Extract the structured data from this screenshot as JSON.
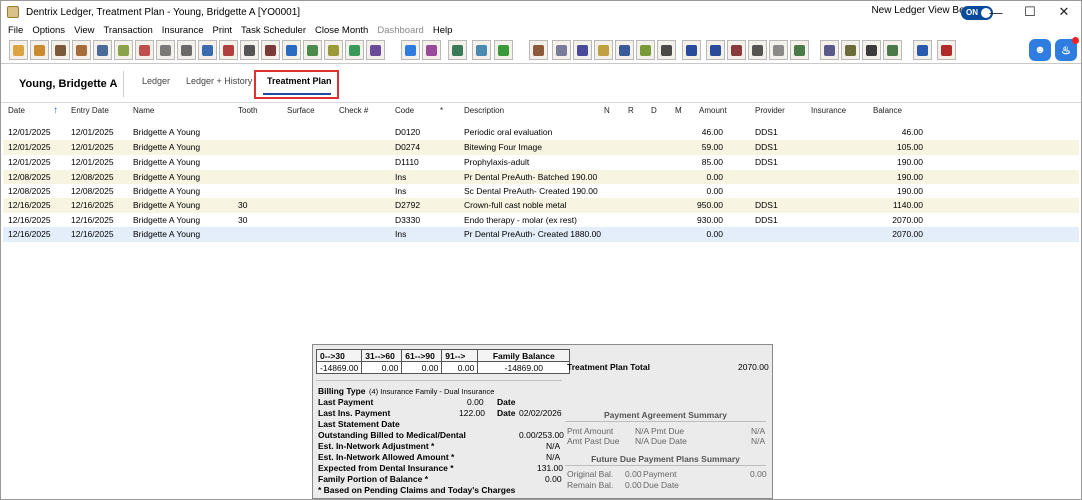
{
  "window": {
    "title": "Dentrix Ledger, Treatment Plan - Young, Bridgette A [YO0001]",
    "beta_label": "New Ledger View Beta",
    "toggle_label": "ON"
  },
  "menu": [
    "File",
    "Options",
    "View",
    "Transaction",
    "Insurance",
    "Print",
    "Task Scheduler",
    "Close Month",
    "Dashboard",
    "Help"
  ],
  "patient_name": "Young, Bridgette A",
  "tabs": [
    "Ledger",
    "Ledger + History",
    "Treatment Plan"
  ],
  "columns": [
    "Date",
    "Entry Date",
    "Name",
    "Tooth",
    "Surface",
    "Check #",
    "Code",
    "*",
    "Description",
    "N",
    "R",
    "D",
    "M",
    "Amount",
    "Provider",
    "Insurance",
    "Balance"
  ],
  "rows": [
    {
      "date": "12/01/2025",
      "entry": "12/01/2025",
      "name": "Bridgette A Young",
      "tooth": "",
      "code": "D0120",
      "desc": "Periodic oral evaluation",
      "amount": "46.00",
      "provider": "DDS1",
      "balance": "46.00"
    },
    {
      "date": "12/01/2025",
      "entry": "12/01/2025",
      "name": "Bridgette A Young",
      "tooth": "",
      "code": "D0274",
      "desc": "Bitewing Four Image",
      "amount": "59.00",
      "provider": "DDS1",
      "balance": "105.00"
    },
    {
      "date": "12/01/2025",
      "entry": "12/01/2025",
      "name": "Bridgette A Young",
      "tooth": "",
      "code": "D1110",
      "desc": "Prophylaxis-adult",
      "amount": "85.00",
      "provider": "DDS1",
      "balance": "190.00"
    },
    {
      "date": "12/08/2025",
      "entry": "12/08/2025",
      "name": "Bridgette A Young",
      "tooth": "",
      "code": "Ins",
      "desc": "Pr Dental PreAuth- Batched 190.00",
      "amount": "0.00",
      "provider": "",
      "balance": "190.00"
    },
    {
      "date": "12/08/2025",
      "entry": "12/08/2025",
      "name": "Bridgette A Young",
      "tooth": "",
      "code": "Ins",
      "desc": "Sc Dental PreAuth- Created 190.00",
      "amount": "0.00",
      "provider": "",
      "balance": "190.00"
    },
    {
      "date": "12/16/2025",
      "entry": "12/16/2025",
      "name": "Bridgette A Young",
      "tooth": "30",
      "code": "D2792",
      "desc": "Crown-full cast noble metal",
      "amount": "950.00",
      "provider": "DDS1",
      "balance": "1140.00"
    },
    {
      "date": "12/16/2025",
      "entry": "12/16/2025",
      "name": "Bridgette A Young",
      "tooth": "30",
      "code": "D3330",
      "desc": "Endo therapy - molar (ex rest)",
      "amount": "930.00",
      "provider": "DDS1",
      "balance": "2070.00"
    },
    {
      "date": "12/16/2025",
      "entry": "12/16/2025",
      "name": "Bridgette A Young",
      "tooth": "",
      "code": "Ins",
      "desc": "Pr Dental PreAuth- Created 1880.00",
      "amount": "0.00",
      "provider": "",
      "balance": "2070.00"
    }
  ],
  "aging": {
    "headers": [
      "0-->30",
      "31-->60",
      "61-->90",
      "91-->",
      "Family Balance"
    ],
    "values": [
      "-14869.00",
      "0.00",
      "0.00",
      "0.00",
      "-14869.00"
    ]
  },
  "summary": {
    "tp_total_label": "Treatment Plan Total",
    "tp_total": "2070.00",
    "billing_type_label": "Billing Type",
    "billing_type": "(4) Insurance Family - Dual Insurance",
    "last_payment_label": "Last Payment",
    "last_payment": "0.00",
    "date_label": "Date",
    "date1": "",
    "last_ins_label": "Last Ins. Payment",
    "last_ins": "122.00",
    "date2": "02/02/2026",
    "last_stmt_label": "Last Statement Date",
    "outstanding_label": "Outstanding Billed to Medical/Dental",
    "outstanding": "0.00/253.00",
    "adj_label": "Est. In-Network Adjustment *",
    "adj": "N/A",
    "allowed_label": "Est. In-Network Allowed Amount *",
    "allowed": "N/A",
    "expected_label": "Expected from Dental Insurance *",
    "expected": "131.00",
    "family_label": "Family Portion of Balance *",
    "family": "0.00",
    "note": "* Based on Pending Claims and Today's Charges",
    "pas_title": "Payment Agreement Summary",
    "pmt_amount_label": "Pmt Amount",
    "pmt_amount": "N/A",
    "pmt_due_label": "Pmt Due",
    "pmt_due": "N/A",
    "amt_past_label": "Amt Past Due",
    "amt_past": "N/A",
    "due_date_label": "Due Date",
    "due_date": "N/A",
    "fpp_title": "Future Due Payment Plans Summary",
    "orig_label": "Original Bal.",
    "orig": "0.00",
    "payment_label": "Payment",
    "payment": "0.00",
    "remain_label": "Remain Bal.",
    "remain": "0.00",
    "fdue_label": "Due Date",
    "fdue": ""
  }
}
